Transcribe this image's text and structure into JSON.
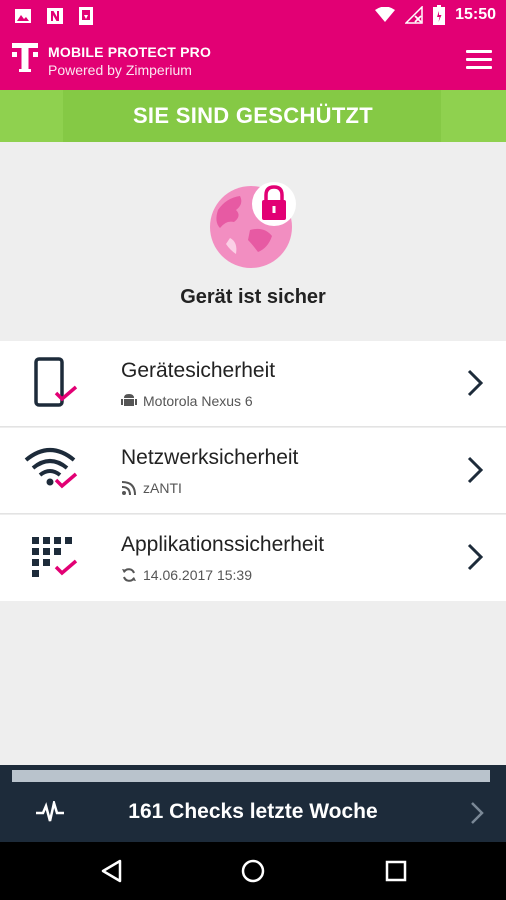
{
  "statusbar": {
    "time": "15:50",
    "left_icons": [
      "image-icon",
      "n-icon",
      "download-icon"
    ],
    "right_icons": [
      "wifi-icon",
      "no-signal-icon",
      "battery-icon"
    ]
  },
  "appbar": {
    "title": "MOBILE PROTECT PRO",
    "subtitle": "Powered by Zimperium",
    "brand_color": "#e20074"
  },
  "banner": {
    "text": "SIE SIND GESCHÜTZT",
    "color": "#8fd14f"
  },
  "hero": {
    "status_text": "Gerät ist sicher",
    "icon": "globe-lock-icon"
  },
  "security_items": [
    {
      "title": "Gerätesicherheit",
      "detail": "Motorola Nexus 6",
      "icon": "phone-check-icon",
      "detail_icon": "android-icon"
    },
    {
      "title": "Netzwerksicherheit",
      "detail": "zANTI",
      "icon": "wifi-check-icon",
      "detail_icon": "feed-icon"
    },
    {
      "title": "Applikationssicherheit",
      "detail": "14.06.2017 15:39",
      "icon": "apps-check-icon",
      "detail_icon": "sync-icon"
    }
  ],
  "footer": {
    "checks_text": "161 Checks letzte Woche",
    "progress": 1.0,
    "icon": "pulse-icon"
  },
  "navbar": {
    "buttons": [
      "back-icon",
      "home-icon",
      "recent-apps-icon"
    ]
  }
}
